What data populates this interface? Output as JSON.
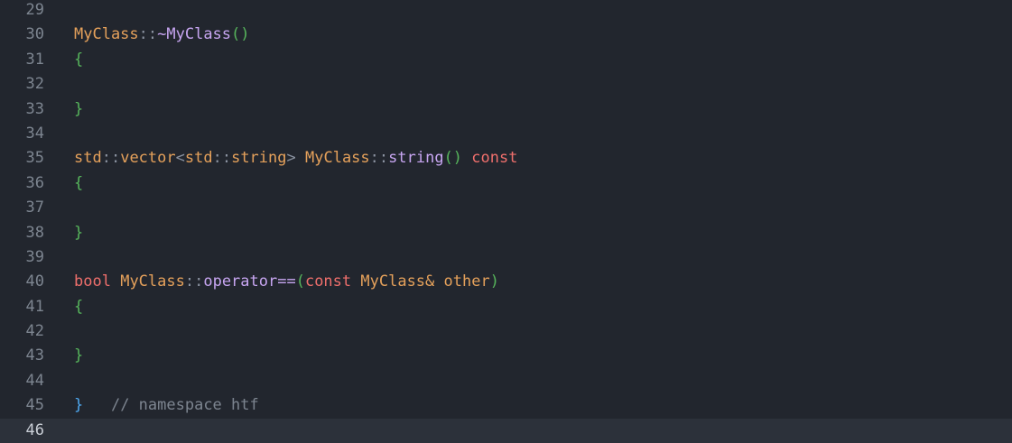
{
  "editor": {
    "lines": [
      {
        "number": "29",
        "tokens": []
      },
      {
        "number": "30",
        "tokens": [
          {
            "text": "MyClass",
            "kind": "type"
          },
          {
            "text": "::",
            "kind": "punct"
          },
          {
            "text": "~MyClass",
            "kind": "func"
          },
          {
            "text": "()",
            "kind": "brace"
          }
        ]
      },
      {
        "number": "31",
        "tokens": [
          {
            "text": "{",
            "kind": "brace"
          }
        ]
      },
      {
        "number": "32",
        "tokens": []
      },
      {
        "number": "33",
        "tokens": [
          {
            "text": "}",
            "kind": "brace"
          }
        ]
      },
      {
        "number": "34",
        "tokens": []
      },
      {
        "number": "35",
        "tokens": [
          {
            "text": "std",
            "kind": "ns"
          },
          {
            "text": "::",
            "kind": "punct"
          },
          {
            "text": "vector",
            "kind": "ns"
          },
          {
            "text": "<",
            "kind": "punct"
          },
          {
            "text": "std",
            "kind": "ns"
          },
          {
            "text": "::",
            "kind": "punct"
          },
          {
            "text": "string",
            "kind": "ns"
          },
          {
            "text": ">",
            "kind": "punct"
          },
          {
            "text": " ",
            "kind": "plain"
          },
          {
            "text": "MyClass",
            "kind": "type"
          },
          {
            "text": "::",
            "kind": "punct"
          },
          {
            "text": "string",
            "kind": "func"
          },
          {
            "text": "()",
            "kind": "brace"
          },
          {
            "text": " ",
            "kind": "plain"
          },
          {
            "text": "const",
            "kind": "kw"
          }
        ]
      },
      {
        "number": "36",
        "tokens": [
          {
            "text": "{",
            "kind": "brace"
          }
        ]
      },
      {
        "number": "37",
        "tokens": []
      },
      {
        "number": "38",
        "tokens": [
          {
            "text": "}",
            "kind": "brace"
          }
        ]
      },
      {
        "number": "39",
        "tokens": []
      },
      {
        "number": "40",
        "tokens": [
          {
            "text": "bool",
            "kind": "kw"
          },
          {
            "text": " ",
            "kind": "plain"
          },
          {
            "text": "MyClass",
            "kind": "type"
          },
          {
            "text": "::",
            "kind": "punct"
          },
          {
            "text": "operator==",
            "kind": "op"
          },
          {
            "text": "(",
            "kind": "brace"
          },
          {
            "text": "const",
            "kind": "kw"
          },
          {
            "text": " ",
            "kind": "plain"
          },
          {
            "text": "MyClass&",
            "kind": "type"
          },
          {
            "text": " ",
            "kind": "plain"
          },
          {
            "text": "other",
            "kind": "param"
          },
          {
            "text": ")",
            "kind": "brace"
          }
        ]
      },
      {
        "number": "41",
        "tokens": [
          {
            "text": "{",
            "kind": "brace"
          }
        ]
      },
      {
        "number": "42",
        "tokens": []
      },
      {
        "number": "43",
        "tokens": [
          {
            "text": "}",
            "kind": "brace"
          }
        ]
      },
      {
        "number": "44",
        "tokens": []
      },
      {
        "number": "45",
        "tokens": [
          {
            "text": "}",
            "kind": "nsbrace"
          },
          {
            "text": "   ",
            "kind": "plain"
          },
          {
            "text": "// namespace htf",
            "kind": "comment"
          }
        ]
      },
      {
        "number": "46",
        "tokens": [],
        "current": true
      }
    ]
  },
  "colors": {
    "background": "#22262e",
    "current_line": "#2c313a",
    "line_number": "#7d8590",
    "type": "#e5a15b",
    "function": "#c8a6f2",
    "brace": "#57b65c",
    "keyword": "#ef6f6c",
    "comment": "#7d8590",
    "namespace_brace": "#4fa8f0"
  }
}
